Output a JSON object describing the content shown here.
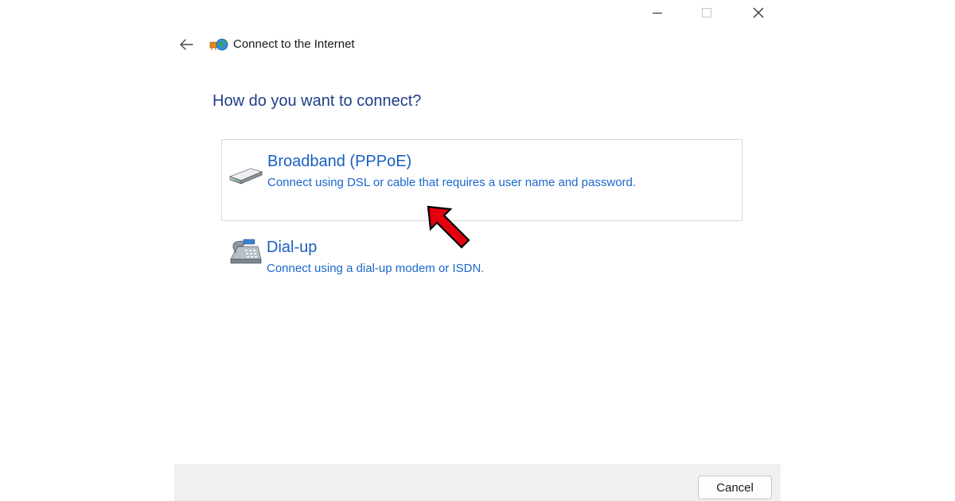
{
  "window": {
    "title": "Connect to the Internet",
    "controls": {
      "minimize": "minimize-icon",
      "maximize": "maximize-icon",
      "close": "close-icon"
    }
  },
  "header": {
    "back_icon": "back-arrow-icon",
    "app_icon": "network-globe-icon"
  },
  "main": {
    "question": "How do you want to connect?",
    "options": [
      {
        "title": "Broadband (PPPoE)",
        "description": "Connect using DSL or cable that requires a user name and password.",
        "icon": "broadband-modem-icon",
        "highlighted": true
      },
      {
        "title": "Dial-up",
        "description": "Connect using a dial-up modem or ISDN.",
        "icon": "dialup-phone-icon",
        "highlighted": false
      }
    ]
  },
  "annotation": {
    "icon": "red-pointer-arrow-icon",
    "color": "#e3000f"
  },
  "footer": {
    "cancel_label": "Cancel"
  },
  "colors": {
    "heading": "#1e3e8a",
    "link": "#1a5fc0",
    "footer_bg": "#f0f0f0"
  }
}
